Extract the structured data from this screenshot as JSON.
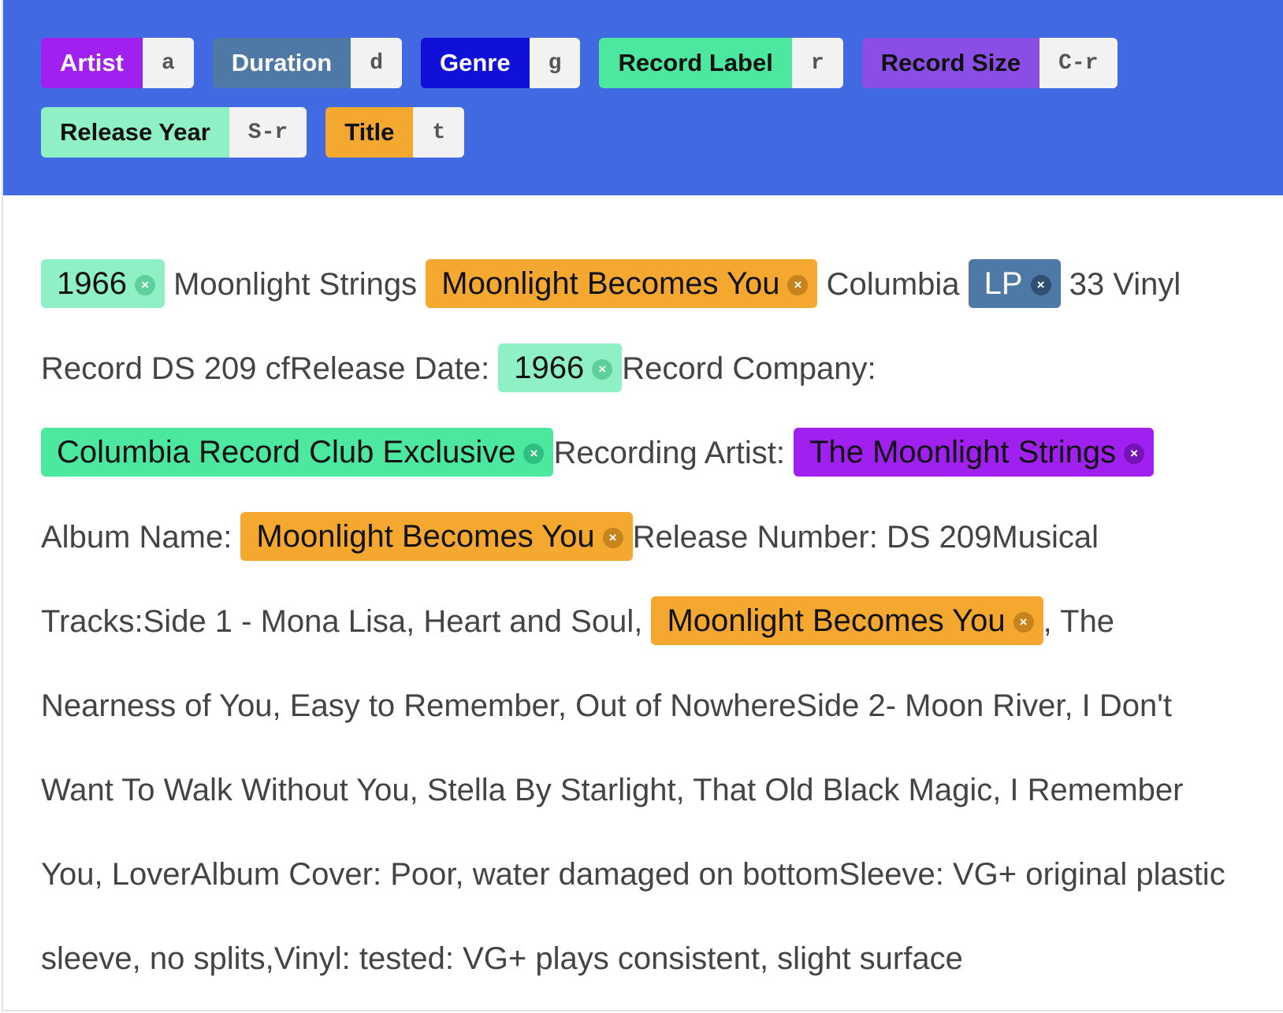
{
  "labels": [
    {
      "name": "Artist",
      "key": "a",
      "bg": "#a020f0",
      "fg": "#ffffff"
    },
    {
      "name": "Duration",
      "key": "d",
      "bg": "#4e79a7",
      "fg": "#ffffff"
    },
    {
      "name": "Genre",
      "key": "g",
      "bg": "#1010d8",
      "fg": "#ffffff"
    },
    {
      "name": "Record Label",
      "key": "r",
      "bg": "#4ce8a0",
      "fg": "#111111"
    },
    {
      "name": "Record Size",
      "key": "C-r",
      "bg": "#8a4ee6",
      "fg": "#111111"
    },
    {
      "name": "Release Year",
      "key": "S-r",
      "bg": "#8ef0c4",
      "fg": "#111111"
    },
    {
      "name": "Title",
      "key": "t",
      "bg": "#f5a830",
      "fg": "#111111"
    }
  ],
  "tokens": [
    {
      "type": "span",
      "label": "Release Year",
      "text": "1966"
    },
    {
      "type": "text",
      "text": " Moonlight Strings "
    },
    {
      "type": "span",
      "label": "Title",
      "text": "Moonlight Becomes You"
    },
    {
      "type": "text",
      "text": " Columbia "
    },
    {
      "type": "span",
      "label": "Record Size",
      "text": "LP"
    },
    {
      "type": "text",
      "text": " 33 Vinyl Record DS 209 cfRelease Date: "
    },
    {
      "type": "span",
      "label": "Release Year",
      "text": "1966"
    },
    {
      "type": "text",
      "text": "Record Company: "
    },
    {
      "type": "span",
      "label": "Record Label",
      "text": "Columbia Record Club Exclusive"
    },
    {
      "type": "text",
      "text": "Recording Artist: "
    },
    {
      "type": "span",
      "label": "Artist",
      "text": "The Moonlight Strings"
    },
    {
      "type": "text",
      "text": " Album Name: "
    },
    {
      "type": "span",
      "label": "Title",
      "text": "Moonlight Becomes You"
    },
    {
      "type": "text",
      "text": "Release Number: DS 209Musical Tracks:Side 1 - Mona Lisa, Heart and Soul, "
    },
    {
      "type": "span",
      "label": "Title",
      "text": "Moonlight Becomes You"
    },
    {
      "type": "text",
      "text": ", The Nearness of You, Easy to Remember, Out of NowhereSide 2- Moon River, I Don't Want To Walk Without You, Stella By Starlight, That Old Black Magic, I Remember You, LoverAlbum Cover: Poor, water damaged on bottomSleeve:  VG+ original plastic sleeve, no splits,Vinyl:  tested: VG+  plays consistent, slight surface"
    }
  ],
  "span_colors": {
    "Release Year": {
      "bg": "#8ef0c4",
      "fg": "#111111",
      "x_bg": "#5fcf9c",
      "x_fg": "#ffffff"
    },
    "Title": {
      "bg": "#f5a830",
      "fg": "#111111",
      "x_bg": "#c7841c",
      "x_fg": "#ffffff"
    },
    "Record Size": {
      "bg": "#4e79a7",
      "fg": "#ffffff",
      "x_bg": "#2f4f73",
      "x_fg": "#ffffff"
    },
    "Record Label": {
      "bg": "#4ce8a0",
      "fg": "#111111",
      "x_bg": "#2fbf7e",
      "x_fg": "#ffffff"
    },
    "Artist": {
      "bg": "#a020f0",
      "fg": "#111111",
      "x_bg": "#7512b8",
      "x_fg": "#ffffff"
    }
  },
  "close_glyph": "×"
}
